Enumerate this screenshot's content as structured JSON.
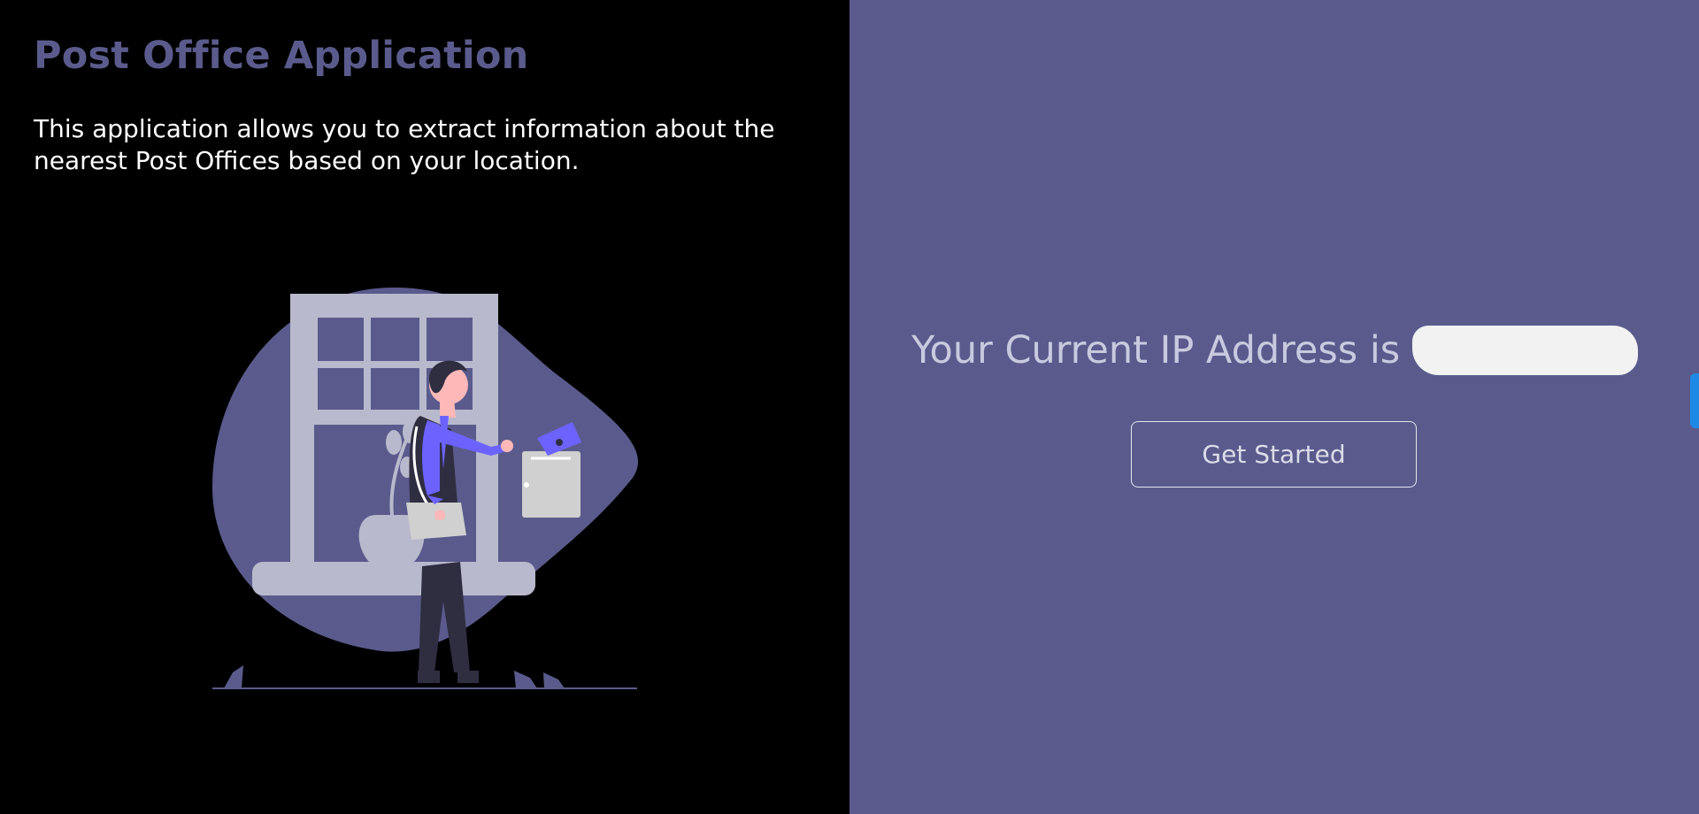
{
  "app": {
    "title": "Post Office Application",
    "description": "This application allows you to extract information about the nearest Post Offices based on your location."
  },
  "illustration": {
    "icon": "mail-delivery-illustration",
    "colors": {
      "blob": "#5a5b8c",
      "accent": "#6c63ff",
      "window": "#b8b9cc",
      "mailbox": "#d0d0d0",
      "skin": "#ffb8b8",
      "dark": "#2f2e41"
    }
  },
  "ip_panel": {
    "label": "Your Current IP Address is",
    "value": "",
    "value_state": "redacted"
  },
  "cta": {
    "label": "Get Started"
  },
  "colors": {
    "left_background": "#000000",
    "right_background": "#5a5b8c",
    "title": "#5a5b8c",
    "edge_tab": "#1e88e5"
  }
}
